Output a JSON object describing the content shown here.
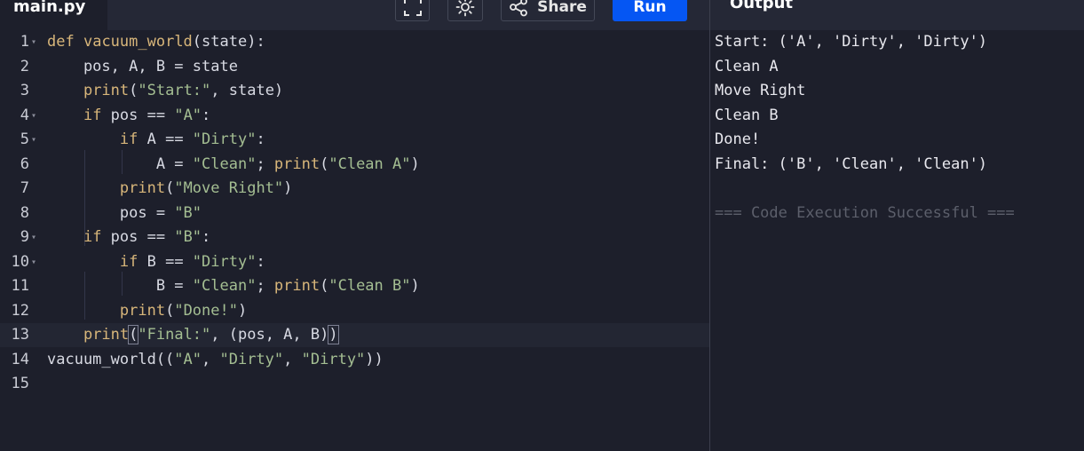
{
  "header": {
    "file_tab": "main.py",
    "share_label": "Share",
    "run_label": "Run",
    "output_title": "Output",
    "icons": [
      "fullscreen-icon",
      "theme-sun-icon",
      "share-icon"
    ]
  },
  "colors": {
    "background": "#1d1f2b",
    "header": "#252836",
    "run_button": "#0556f3",
    "keyword": "#d8b67a",
    "string": "#a4be92"
  },
  "editor": {
    "line_numbers": [
      "1",
      "2",
      "3",
      "4",
      "5",
      "6",
      "7",
      "8",
      "9",
      "10",
      "11",
      "12",
      "13",
      "14",
      "15"
    ],
    "active_line": 13
  },
  "code": {
    "l1": {
      "kw": "def",
      "fn": "vacuum_world",
      "rest": "(state):"
    },
    "l2": {
      "text": "    pos, A, B = state"
    },
    "l3": {
      "fn": "print",
      "open": "(",
      "s1": "\"Start:\"",
      "rest": ", state)"
    },
    "l4": {
      "kw": "if",
      "mid": " pos == ",
      "s1": "\"A\"",
      "rest": ":"
    },
    "l5": {
      "kw": "if",
      "mid": " A == ",
      "s1": "\"Dirty\"",
      "rest": ":"
    },
    "l6": {
      "pre": "A = ",
      "s1": "\"Clean\"",
      "mid": "; ",
      "fn": "print",
      "open": "(",
      "s2": "\"Clean A\"",
      "rest": ")"
    },
    "l7": {
      "fn": "print",
      "open": "(",
      "s1": "\"Move Right\"",
      "rest": ")"
    },
    "l8": {
      "pre": "pos = ",
      "s1": "\"B\""
    },
    "l9": {
      "kw": "if",
      "mid": " pos == ",
      "s1": "\"B\"",
      "rest": ":"
    },
    "l10": {
      "kw": "if",
      "mid": " B == ",
      "s1": "\"Dirty\"",
      "rest": ":"
    },
    "l11": {
      "pre": "B = ",
      "s1": "\"Clean\"",
      "mid": "; ",
      "fn": "print",
      "open": "(",
      "s2": "\"Clean B\"",
      "rest": ")"
    },
    "l12": {
      "fn": "print",
      "open": "(",
      "s1": "\"Done!\"",
      "rest": ")"
    },
    "l13": {
      "fn": "print",
      "open": "(",
      "s1": "\"Final:\"",
      "mid": ", (pos, A, B)",
      "close": ")"
    },
    "l14": {
      "pre": "vacuum_world((",
      "s1": "\"A\"",
      "c1": ", ",
      "s2": "\"Dirty\"",
      "c2": ", ",
      "s3": "\"Dirty\"",
      "rest": "))"
    }
  },
  "output": {
    "lines": [
      "Start: ('A', 'Dirty', 'Dirty')",
      "Clean A",
      "Move Right",
      "Clean B",
      "Done!",
      "Final: ('B', 'Clean', 'Clean')"
    ],
    "success": "=== Code Execution Successful ==="
  }
}
